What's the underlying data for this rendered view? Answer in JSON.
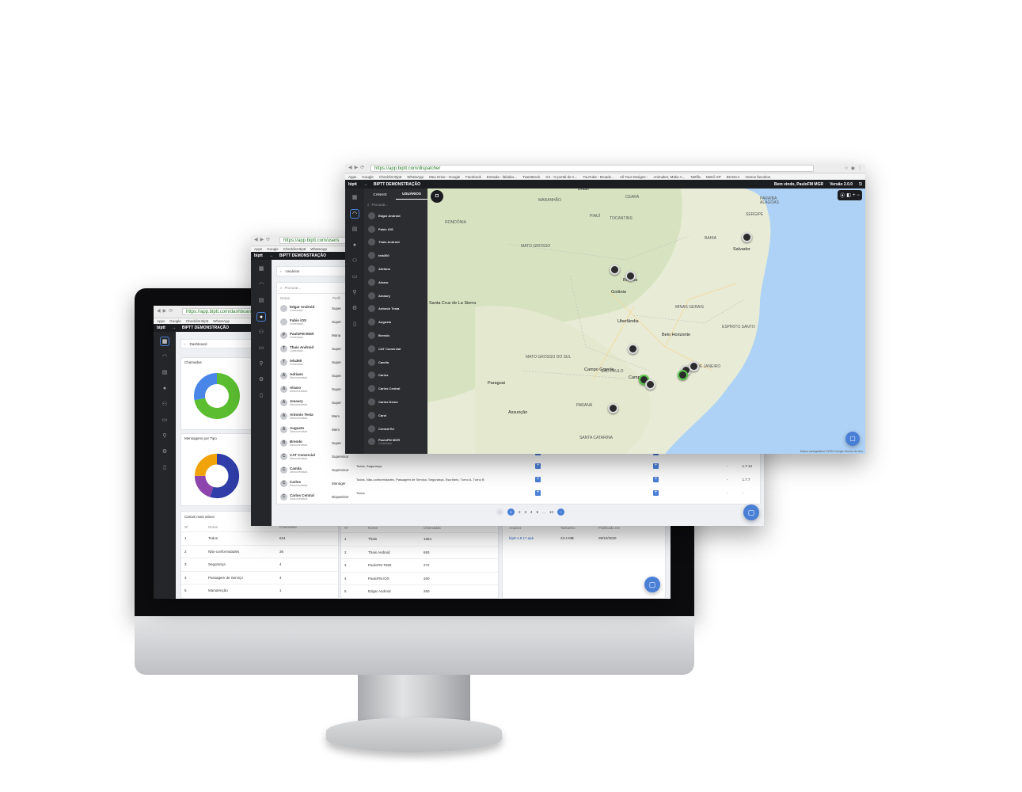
{
  "dashboard": {
    "url": "https://app.biptt.com/dashboard",
    "bookmarks": [
      "Apps",
      "Google",
      "Checklist Biptt",
      "WhatsApp"
    ],
    "brand": "biptt",
    "org": "BIPTT DEMONSTRAÇÃO",
    "breadcrumb": "Dashboard",
    "calls_title": "Chamadas",
    "messages_title": "Mensagens por Tipo",
    "channels_title": "Canais mais ativos",
    "channels_headers": [
      "Nº",
      "Nome",
      "Chamadas"
    ],
    "channels": [
      {
        "n": "1",
        "name": "Todos",
        "calls": "624"
      },
      {
        "n": "2",
        "name": "Não-conformidades",
        "calls": "36"
      },
      {
        "n": "3",
        "name": "Segurança",
        "calls": "4"
      },
      {
        "n": "4",
        "name": "Passagem de Serviço",
        "calls": "4"
      },
      {
        "n": "5",
        "name": "Manutenção",
        "calls": "1"
      }
    ],
    "users_headers": [
      "Nº",
      "Nome",
      "Chamadas"
    ],
    "users": [
      {
        "n": "1",
        "name": "Thais",
        "calls": "1554"
      },
      {
        "n": "2",
        "name": "Thais Android",
        "calls": "693"
      },
      {
        "n": "3",
        "name": "PauloFM T590",
        "calls": "272"
      },
      {
        "n": "4",
        "name": "PauloFM iOS",
        "calls": "260"
      },
      {
        "n": "5",
        "name": "Edgar Android",
        "calls": "260"
      }
    ],
    "files_headers": [
      "Arquivo",
      "Tamanho",
      "Publicado em"
    ],
    "files": [
      {
        "name": "biptt-1.9.17.apk",
        "size": "23.4 MB",
        "date": "09/10/2020"
      }
    ],
    "donut_calls": [
      {
        "value": 72,
        "color": "#5bbd2f"
      },
      {
        "value": 28,
        "color": "#4a86e8"
      }
    ],
    "donut_msgs": [
      {
        "value": 55,
        "color": "#2f3ea8"
      },
      {
        "value": 20,
        "color": "#8e44ad"
      },
      {
        "value": 25,
        "color": "#f0a30a"
      }
    ]
  },
  "users_page": {
    "url": "https://app.biptt.com/users",
    "bookmarks": [
      "Apps",
      "Google",
      "Checklist Biptt",
      "WhatsApp"
    ],
    "brand": "biptt",
    "org": "BIPTT DEMONSTRAÇÃO",
    "breadcrumb": "Usuários",
    "search_placeholder": "Procurar...",
    "headers": [
      "Nome",
      "Perfil"
    ],
    "users": [
      {
        "initial": "",
        "name": "Edgar Android",
        "status": "Conectado",
        "profile": "Super"
      },
      {
        "initial": "",
        "name": "Fabio iOS",
        "status": "Conectado",
        "profile": "Super"
      },
      {
        "initial": "P",
        "name": "PauloFM MGR",
        "status": "Conectado",
        "profile": "Mana"
      },
      {
        "initial": "T",
        "name": "Thais Android",
        "status": "Conectado",
        "profile": "Super"
      },
      {
        "initial": "T",
        "name": "tela360",
        "status": "Conectado",
        "profile": "Super"
      },
      {
        "initial": "A",
        "name": "Adriano",
        "status": "Desconectado",
        "profile": "Super"
      },
      {
        "initial": "A",
        "name": "Alvaro",
        "status": "Desconectado",
        "profile": "Super"
      },
      {
        "initial": "A",
        "name": "Amaury",
        "status": "Desconectado",
        "profile": "Super"
      },
      {
        "initial": "A",
        "name": "Antonio Testa",
        "status": "Desconectado",
        "profile": "Mem"
      },
      {
        "initial": "A",
        "name": "Augusto",
        "status": "Desconectado",
        "profile": "Mem"
      },
      {
        "initial": "B",
        "name": "Brendo",
        "status": "Desconectado",
        "profile": "Super"
      },
      {
        "initial": "C",
        "name": "CAT Comercial",
        "status": "Desconectado",
        "profile": "Supervisor"
      },
      {
        "initial": "C",
        "name": "Camila",
        "status": "Desconectado",
        "profile": "Supervisor"
      },
      {
        "initial": "C",
        "name": "Carlos",
        "status": "Desconectado",
        "profile": "Manager"
      },
      {
        "initial": "C",
        "name": "Carlos Central",
        "status": "Desconectado",
        "profile": "Dispatcher"
      }
    ],
    "bottom_rows": [
      {
        "channels": "Todos",
        "version": "1.7.8"
      },
      {
        "channels": "Todos, Segurança",
        "version": "1.7.14"
      },
      {
        "channels": "Todos, Não-conformidades, Passagem de Serviço, Segurança, Escritório, Turno A, Turno B",
        "version": "1.7.7"
      },
      {
        "channels": "Todos",
        "version": "-"
      }
    ],
    "dash": "-",
    "pages": [
      "1",
      "2",
      "3",
      "4",
      "5",
      "...",
      "13"
    ]
  },
  "dispatcher": {
    "url": "https://app.biptt.com/dispatcher",
    "bookmarks": [
      "Apps",
      "Google",
      "Checklist Biptt",
      "WhatsApp",
      "Meu Drive - Google",
      "Facebook",
      "Entrada - fabiabo...",
      "TweetDeck",
      "G1 - O portal de n...",
      "YouTube - Broadc...",
      "All Your Designs -",
      "Animaker, Make A...",
      "Netflix",
      "Metrô SP",
      "BIANCA",
      "Outros favoritos"
    ],
    "brand": "biptt",
    "org": "BIPTT DEMONSTRAÇÃO",
    "welcome": "Bem vindo, PauloFM MGR",
    "version": "Versão 2.0.0",
    "tabs": [
      "CANAIS",
      "USUÁRIOS"
    ],
    "search_placeholder": "Procurar...",
    "users": [
      "Edgar Android",
      "Fabio iOS",
      "Thais Android",
      "tela360",
      "Adriano",
      "Alvaro",
      "Amaury",
      "Antonio Testa",
      "Augusto",
      "Brendo",
      "CAT Comercial",
      "Camila",
      "Carlos",
      "Carlos Central",
      "Carlos Demo",
      "Carol",
      "Central RJ",
      "PauloFM MGR"
    ],
    "last_status": "Conectado",
    "map_labels": [
      {
        "t": "Brasil",
        "c": "city"
      },
      {
        "t": "MARANHÃO",
        "c": ""
      },
      {
        "t": "CEARÁ",
        "c": ""
      },
      {
        "t": "PIAUÍ",
        "c": ""
      },
      {
        "t": "PARAÍBA",
        "c": ""
      },
      {
        "t": "ALAGOAS",
        "c": ""
      },
      {
        "t": "SERGIPE",
        "c": ""
      },
      {
        "t": "TOCANTINS",
        "c": ""
      },
      {
        "t": "BAHIA",
        "c": ""
      },
      {
        "t": "MATO GROSSO",
        "c": ""
      },
      {
        "t": "RONDÔNIA",
        "c": ""
      },
      {
        "t": "Santa Cruz de La Sierra",
        "c": "city"
      },
      {
        "t": "Goiânia",
        "c": "city"
      },
      {
        "t": "Brasília",
        "c": "city"
      },
      {
        "t": "MINAS GERAIS",
        "c": ""
      },
      {
        "t": "Belo Horizonte",
        "c": "city"
      },
      {
        "t": "MATO GROSSO DO SUL",
        "c": ""
      },
      {
        "t": "Campo Grande",
        "c": "city"
      },
      {
        "t": "SÃO PAULO",
        "c": ""
      },
      {
        "t": "Campinas",
        "c": "city"
      },
      {
        "t": "RIO DE JANEIRO",
        "c": ""
      },
      {
        "t": "Paraguai",
        "c": "city"
      },
      {
        "t": "Assunção",
        "c": "city"
      },
      {
        "t": "PARANÁ",
        "c": ""
      },
      {
        "t": "SANTA CATARINA",
        "c": ""
      },
      {
        "t": "ESPÍRITO SANTO",
        "c": ""
      },
      {
        "t": "Salvador",
        "c": "city"
      },
      {
        "t": "Uberlândia",
        "c": "city"
      }
    ],
    "map_footer": "Dados cartográficos ©2020 Google   Termos de Uso"
  }
}
